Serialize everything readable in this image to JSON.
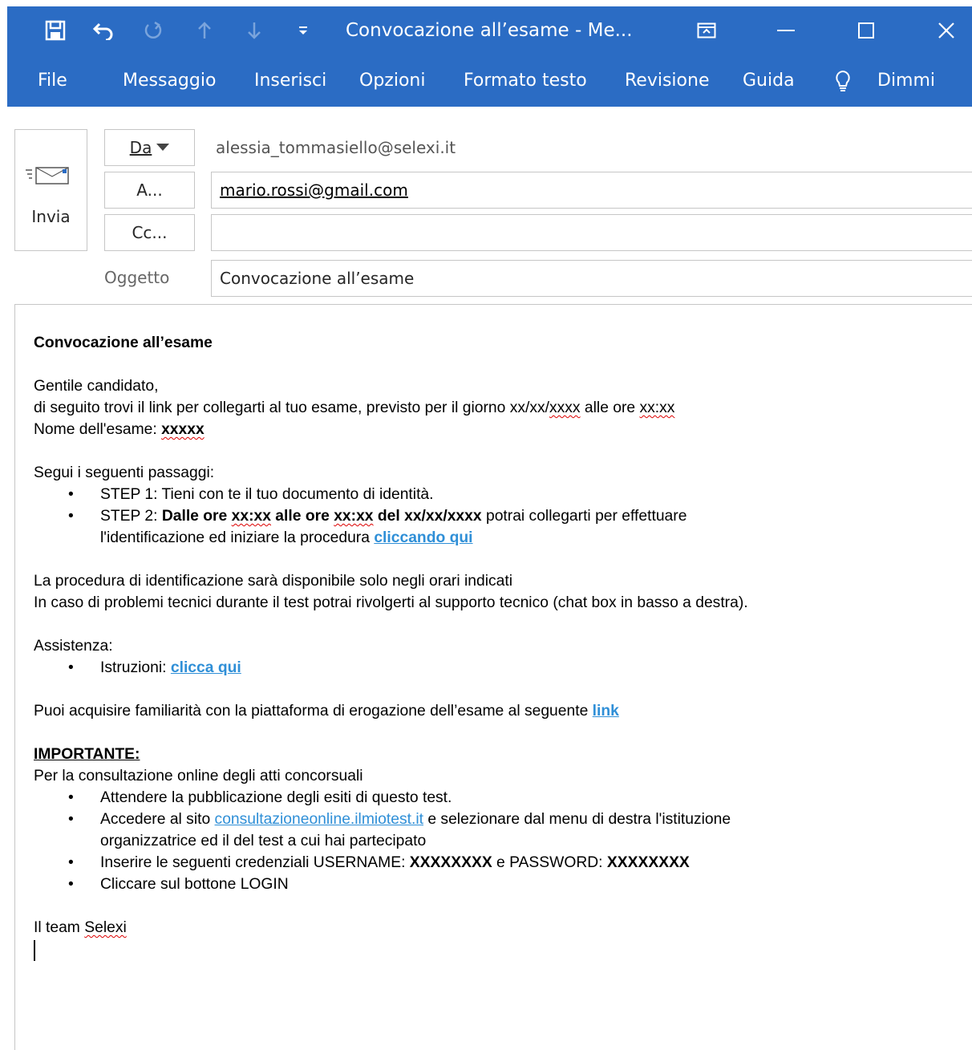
{
  "titlebar": {
    "title": "Convocazione all’esame  -  Me...",
    "icons": [
      "save-icon",
      "undo-icon",
      "redo-icon",
      "up-arrow-icon",
      "down-arrow-icon",
      "customize-qat-icon",
      "ribbon-display-icon",
      "minimize-icon",
      "maximize-icon",
      "close-icon"
    ],
    "glyph_customize": "≡"
  },
  "menu": {
    "file": "File",
    "messaggio": "Messaggio",
    "inserisci": "Inserisci",
    "opzioni": "Opzioni",
    "formato": "Formato testo",
    "revisione": "Revisione",
    "guida": "Guida",
    "dimmi": "Dimmi"
  },
  "header": {
    "send_label": "Invia",
    "from_label": "Da",
    "from_value": "alessia_tommasiello@selexi.it",
    "to_label": "A...",
    "to_value": "mario.rossi@gmail.com",
    "cc_label": "Cc...",
    "cc_value": "",
    "subject_label": "Oggetto",
    "subject_value": "Convocazione all’esame"
  },
  "body": {
    "heading": "Convocazione all’esame",
    "greeting": "Gentile candidato,",
    "intro_1": "di seguito trovi il link per collegarti al tuo esame, previsto per il giorno xx/xx/",
    "intro_date_year": "xxxx",
    "intro_2": " alle ore ",
    "intro_time": "xx:xx",
    "exam_name_label": "Nome dell'esame: ",
    "exam_name_value": "xxxxx",
    "steps_intro": "Segui i seguenti passaggi:",
    "step1": "STEP 1: Tieni con te il tuo documento di identità.",
    "step2_a": "STEP 2: ",
    "step2_b": "Dalle ore ",
    "step2_t1": "xx:xx",
    "step2_c": " alle ore ",
    "step2_t2": "xx:xx",
    "step2_d": " del xx/xx/xxxx",
    "step2_e": " potrai collegarti per effettuare",
    "step2_f": "l'identificazione ed iniziare la procedura ",
    "step2_link": "cliccando qui",
    "proc_note": "La procedura di identificazione sarà disponibile solo negli orari indicati",
    "support_note": "In caso di problemi tecnici durante il test potrai rivolgerti al supporto tecnico (chat box in basso a destra).",
    "assist_label": "Assistenza:",
    "instr_label": "Istruzioni: ",
    "instr_link": "clicca qui",
    "familiar": "Puoi acquisire familiarità con la piattaforma di erogazione dell’esame al seguente ",
    "familiar_link": "link",
    "important": "IMPORTANTE:",
    "consult_intro": "Per la consultazione online degli atti concorsuali",
    "b1": "Attendere la pubblicazione degli esiti di questo test.",
    "b2_a": "Accedere al sito ",
    "b2_link": "consultazioneonline.ilmiotest.it",
    "b2_b": " e selezionare dal menu di destra l'istituzione",
    "b2_c": "organizzatrice ed il del test a cui hai partecipato",
    "b3_a": "Inserire le seguenti credenziali USERNAME: ",
    "b3_user": "XXXXXXXX",
    "b3_b": " e PASSWORD: ",
    "b3_pass": "XXXXXXXX",
    "b4": "Cliccare sul bottone LOGIN",
    "sign_a": "Il team ",
    "sign_b": "Selexi"
  },
  "colors": {
    "accent": "#2b6cc4",
    "link": "#2f8fd7"
  }
}
